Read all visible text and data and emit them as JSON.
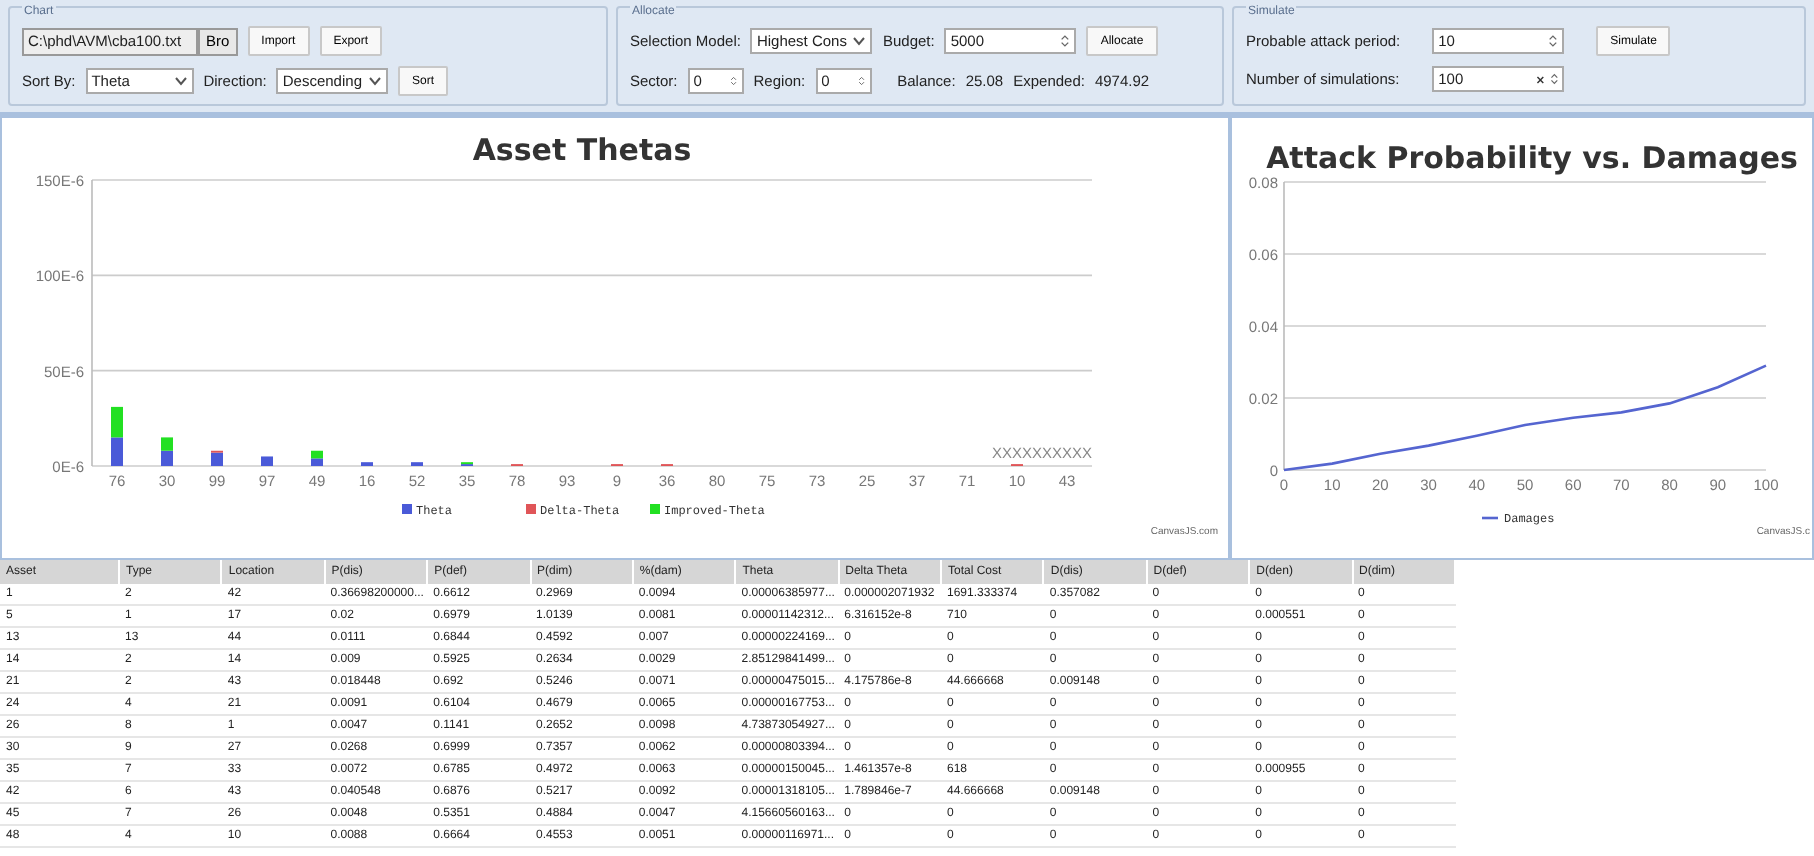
{
  "chart_group": {
    "title": "Chart",
    "file_path": "C:\\phd\\AVM\\cba100.txt",
    "browse_button": "Bro",
    "buttons": [
      "Import",
      "Export"
    ],
    "sort_by_label": "Sort By:",
    "sort_by": "Theta",
    "direction_label": "Direction:",
    "direction": "Descending",
    "sort_button": "Sort"
  },
  "allocate_group": {
    "title": "Allocate",
    "selection_model_label": "Selection Model:",
    "selection_model": "Highest Cons",
    "budget_label": "Budget:",
    "budget": "5000",
    "allocate_button": "Allocate",
    "sector_label": "Sector:",
    "sector": "0",
    "region_label": "Region:",
    "region": "0",
    "balance_label": "Balance:",
    "balance": "25.08",
    "expended_label": "Expended:",
    "expended": "4974.92"
  },
  "simulate_group": {
    "title": "Simulate",
    "attack_period_label": "Probable attack period:",
    "attack_period": "10",
    "simulate_button": "Simulate",
    "simulations_label": "Number of simulations:",
    "simulations": "100"
  },
  "asset_chart": {
    "credit": "CanvasJS.com",
    "chart_data": {
      "type": "bar",
      "title": "Asset Thetas",
      "stacked": true,
      "categories": [
        "76",
        "30",
        "99",
        "97",
        "49",
        "16",
        "52",
        "35",
        "78",
        "93",
        "9",
        "36",
        "80",
        "75",
        "73",
        "25",
        "37",
        "71",
        "10",
        "43"
      ],
      "series": [
        {
          "name": "Theta",
          "color": "#4a5ad8",
          "values": [
            1.5e-05,
            8e-06,
            7e-06,
            5e-06,
            4e-06,
            2e-06,
            2e-06,
            1e-06,
            0,
            0,
            0,
            0,
            0,
            0,
            0,
            0,
            0,
            0,
            0,
            0
          ]
        },
        {
          "name": "Delta-Theta",
          "color": "#e05558",
          "values": [
            0,
            0,
            1e-06,
            0,
            0,
            0,
            0,
            0,
            1e-06,
            0,
            1e-06,
            1e-06,
            0,
            0,
            0,
            0,
            0,
            0,
            1e-06,
            0
          ]
        },
        {
          "name": "Improved-Theta",
          "color": "#22e022",
          "values": [
            1.6e-05,
            7e-06,
            0,
            0,
            4e-06,
            0,
            0,
            1e-06,
            0,
            0,
            0,
            0,
            0,
            0,
            0,
            0,
            0,
            0,
            0,
            0
          ]
        }
      ],
      "ylim": [
        0,
        0.00015
      ],
      "yticks": [
        {
          "value": 0,
          "label": "0E-6"
        },
        {
          "value": 5e-05,
          "label": "50E-6"
        },
        {
          "value": 0.0001,
          "label": "100E-6"
        },
        {
          "value": 0.00015,
          "label": "150E-6"
        }
      ],
      "annotations": [
        "XXXXXXXXXX"
      ],
      "legend": "bottom",
      "grid": true
    }
  },
  "damage_chart": {
    "credit": "CanvasJS.c",
    "chart_data": {
      "type": "line",
      "title": "Attack Probability vs. Damages",
      "x": [
        0,
        10,
        20,
        30,
        40,
        50,
        60,
        70,
        80,
        90,
        100
      ],
      "series": [
        {
          "name": "Damages",
          "color": "#5565d0",
          "values": [
            0,
            0.0018,
            0.0045,
            0.0068,
            0.0095,
            0.0125,
            0.0145,
            0.016,
            0.0185,
            0.023,
            0.029
          ]
        }
      ],
      "xlim": [
        0,
        100
      ],
      "ylim": [
        0,
        0.08
      ],
      "xticks": [
        0,
        10,
        20,
        30,
        40,
        50,
        60,
        70,
        80,
        90,
        100
      ],
      "yticks": [
        0,
        0.02,
        0.04,
        0.06,
        0.08
      ],
      "legend": "bottom",
      "grid": true
    }
  },
  "table": {
    "columns": [
      "Asset",
      "Type",
      "Location",
      "P(dis)",
      "P(def)",
      "P(dim)",
      "%(dam)",
      "Theta",
      "Delta Theta",
      "Total Cost",
      "D(dis)",
      "D(def)",
      "D(den)",
      "D(dim)"
    ],
    "rows": [
      [
        "1",
        "2",
        "42",
        "0.36698200000...",
        "0.6612",
        "0.2969",
        "0.0094",
        "0.00006385977...",
        "0.000002071932",
        "1691.333374",
        "0.357082",
        "0",
        "0",
        "0"
      ],
      [
        "5",
        "1",
        "17",
        "0.02",
        "0.6979",
        "1.0139",
        "0.0081",
        "0.00001142312...",
        "6.316152e-8",
        "710",
        "0",
        "0",
        "0.000551",
        "0"
      ],
      [
        "13",
        "13",
        "44",
        "0.0111",
        "0.6844",
        "0.4592",
        "0.007",
        "0.00000224169...",
        "0",
        "0",
        "0",
        "0",
        "0",
        "0"
      ],
      [
        "14",
        "2",
        "14",
        "0.009",
        "0.5925",
        "0.2634",
        "0.0029",
        "2.85129841499...",
        "0",
        "0",
        "0",
        "0",
        "0",
        "0"
      ],
      [
        "21",
        "2",
        "43",
        "0.018448",
        "0.692",
        "0.5246",
        "0.0071",
        "0.00000475015...",
        "4.175786e-8",
        "44.666668",
        "0.009148",
        "0",
        "0",
        "0"
      ],
      [
        "24",
        "4",
        "21",
        "0.0091",
        "0.6104",
        "0.4679",
        "0.0065",
        "0.00000167753...",
        "0",
        "0",
        "0",
        "0",
        "0",
        "0"
      ],
      [
        "26",
        "8",
        "1",
        "0.0047",
        "0.1141",
        "0.2652",
        "0.0098",
        "4.73873054927...",
        "0",
        "0",
        "0",
        "0",
        "0",
        "0"
      ],
      [
        "30",
        "9",
        "27",
        "0.0268",
        "0.6999",
        "0.7357",
        "0.0062",
        "0.00000803394...",
        "0",
        "0",
        "0",
        "0",
        "0",
        "0"
      ],
      [
        "35",
        "7",
        "33",
        "0.0072",
        "0.6785",
        "0.4972",
        "0.0063",
        "0.00000150045...",
        "1.461357e-8",
        "618",
        "0",
        "0",
        "0.000955",
        "0"
      ],
      [
        "42",
        "6",
        "43",
        "0.040548",
        "0.6876",
        "0.5217",
        "0.0092",
        "0.00001318105...",
        "1.789846e-7",
        "44.666668",
        "0.009148",
        "0",
        "0",
        "0"
      ],
      [
        "45",
        "7",
        "26",
        "0.0048",
        "0.5351",
        "0.4884",
        "0.0047",
        "4.15660560163...",
        "0",
        "0",
        "0",
        "0",
        "0",
        "0"
      ],
      [
        "48",
        "4",
        "10",
        "0.0088",
        "0.6664",
        "0.4553",
        "0.0051",
        "0.00000116971...",
        "0",
        "0",
        "0",
        "0",
        "0",
        "0"
      ]
    ]
  }
}
